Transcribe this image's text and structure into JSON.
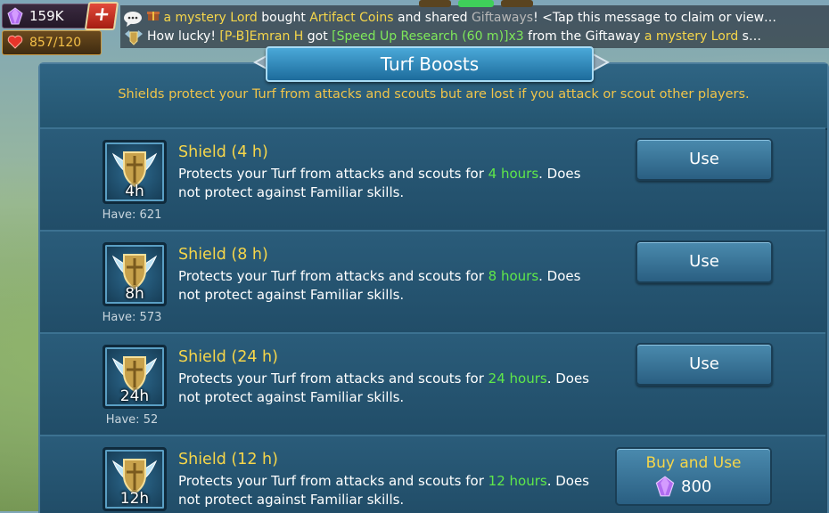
{
  "resources": {
    "gems": "159K",
    "add_label": "+",
    "hp": "857/120"
  },
  "chat": {
    "line1": {
      "p1": "a mystery Lord",
      "p2": " bought ",
      "p3": "Artifact Coins",
      "p4": " and shared ",
      "p5": "Giftaways",
      "p6": "!  <Tap this message to claim or view…"
    },
    "line2": {
      "p1": "How lucky! ",
      "p2": "[P-B]Emran H",
      "p3": " got ",
      "p4": "[Speed Up Research (60 m)]x3",
      "p5": " from the Giftaway ",
      "p6": "a mystery Lord",
      "p7": " s…"
    }
  },
  "panel": {
    "title": "Turf Boosts",
    "subtitle": "Shields protect your Turf from attacks and scouts but are lost if you attack or scout other players."
  },
  "items": [
    {
      "name": "Shield (4 h)",
      "duration": "4h",
      "have": "Have: 621",
      "desc_a": "Protects your Turf from attacks and scouts for ",
      "desc_hl": "4 hours",
      "desc_b": ". Does not protect against Familiar skills.",
      "button": "Use"
    },
    {
      "name": "Shield (8 h)",
      "duration": "8h",
      "have": "Have: 573",
      "desc_a": "Protects your Turf from attacks and scouts for ",
      "desc_hl": "8 hours",
      "desc_b": ". Does not protect against Familiar skills.",
      "button": "Use"
    },
    {
      "name": "Shield (24 h)",
      "duration": "24h",
      "have": "Have: 52",
      "desc_a": "Protects your Turf from attacks and scouts for ",
      "desc_hl": "24 hours",
      "desc_b": ". Does not protect against Familiar skills.",
      "button": "Use"
    },
    {
      "name": "Shield (12 h)",
      "duration": "12h",
      "desc_a": "Protects your Turf from attacks and scouts for ",
      "desc_hl": "12 hours",
      "desc_b": ". Does not protect against Familiar skills.",
      "button": "Buy and Use",
      "price": "800"
    }
  ],
  "colors": {
    "accent_gold": "#f6d64a",
    "highlight_green": "#5fe84a",
    "panel_blue": "#234d66"
  }
}
